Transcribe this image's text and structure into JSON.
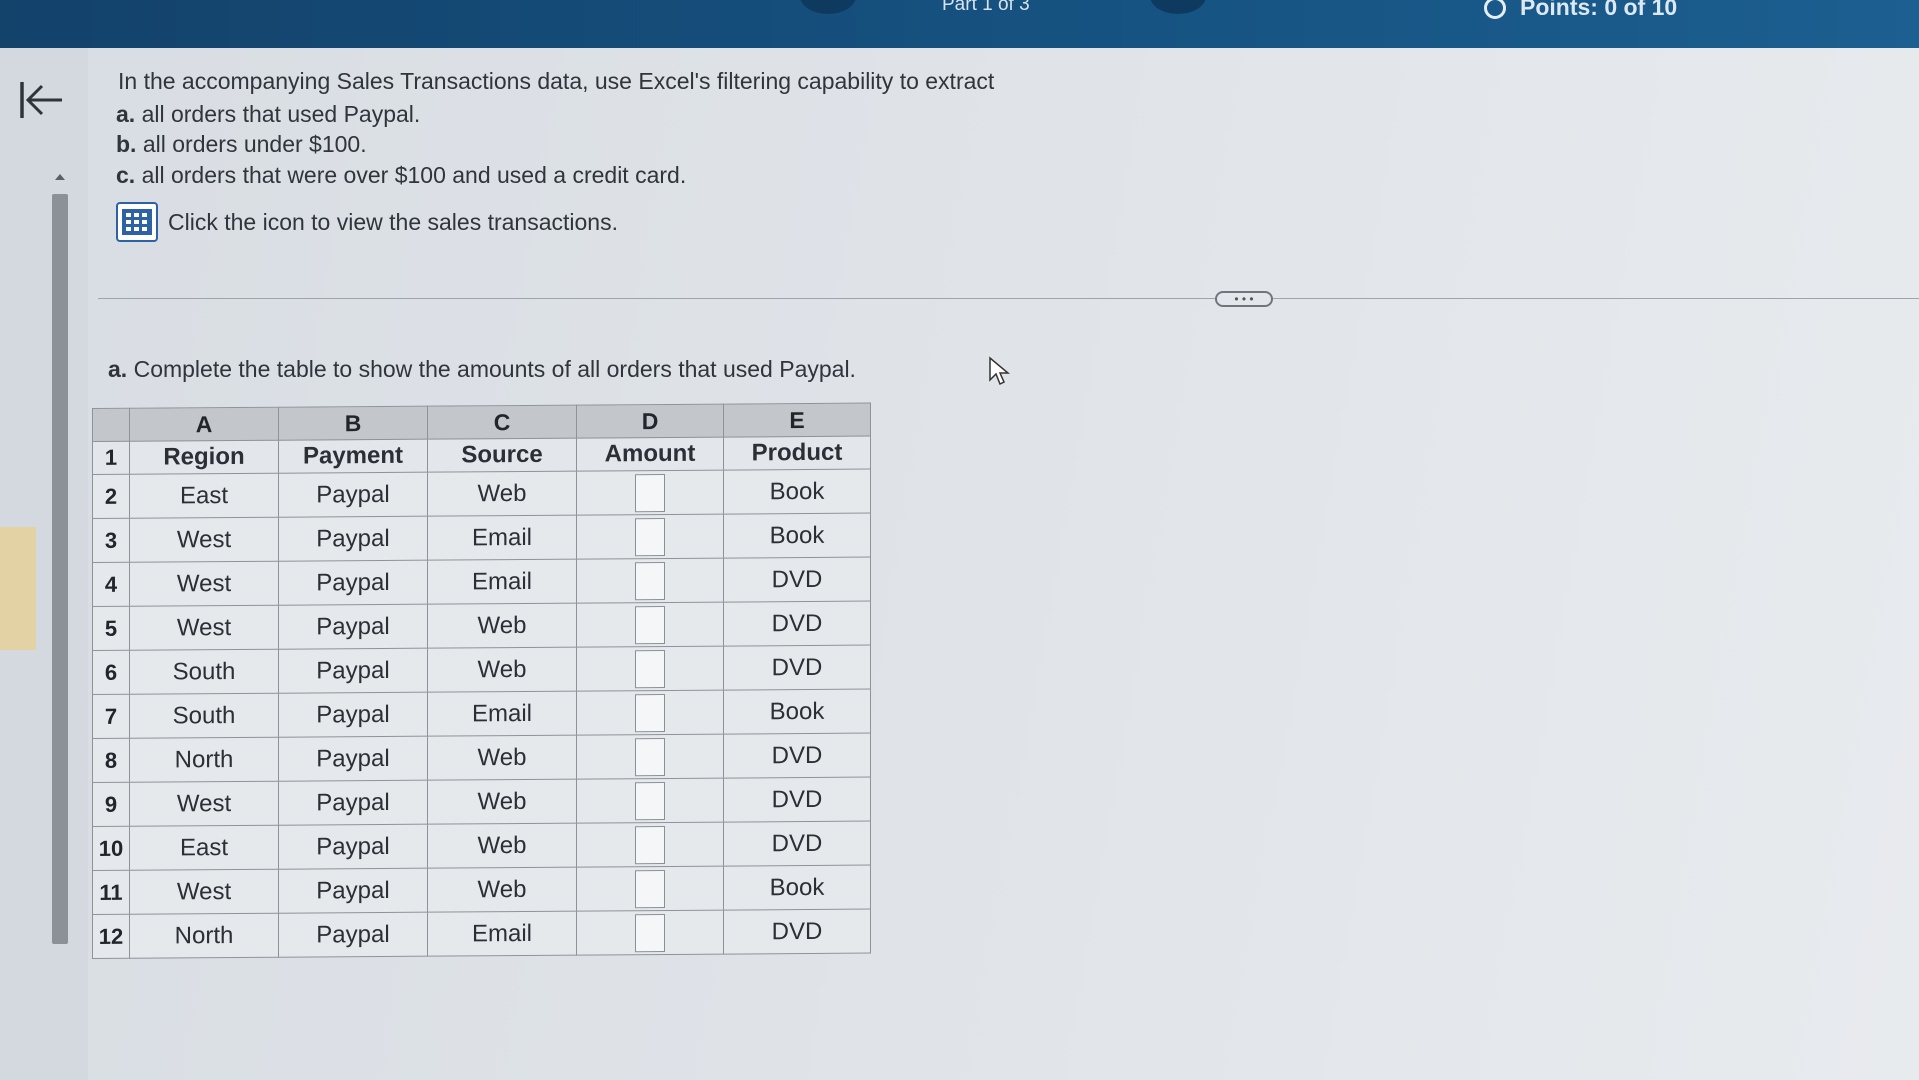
{
  "header": {
    "part": "Part 1 of 3",
    "points": "Points: 0 of 10"
  },
  "question": {
    "intro": "In the accompanying Sales Transactions data, use Excel's filtering capability to extract",
    "items": [
      {
        "letter": "a.",
        "text": "all orders that used Paypal."
      },
      {
        "letter": "b.",
        "text": "all orders under $100."
      },
      {
        "letter": "c.",
        "text": "all orders that were over $100 and used a credit card."
      }
    ],
    "view_link": "Click the icon to view the sales transactions."
  },
  "part_a": {
    "letter": "a.",
    "prompt": "Complete the table to show the amounts of all orders that used Paypal."
  },
  "table": {
    "col_letters": [
      "A",
      "B",
      "C",
      "D",
      "E"
    ],
    "header_row_num": "1",
    "headers": [
      "Region",
      "Payment",
      "Source",
      "Amount",
      "Product"
    ],
    "rows": [
      {
        "num": "2",
        "region": "East",
        "payment": "Paypal",
        "source": "Web",
        "amount": "",
        "product": "Book"
      },
      {
        "num": "3",
        "region": "West",
        "payment": "Paypal",
        "source": "Email",
        "amount": "",
        "product": "Book"
      },
      {
        "num": "4",
        "region": "West",
        "payment": "Paypal",
        "source": "Email",
        "amount": "",
        "product": "DVD"
      },
      {
        "num": "5",
        "region": "West",
        "payment": "Paypal",
        "source": "Web",
        "amount": "",
        "product": "DVD"
      },
      {
        "num": "6",
        "region": "South",
        "payment": "Paypal",
        "source": "Web",
        "amount": "",
        "product": "DVD"
      },
      {
        "num": "7",
        "region": "South",
        "payment": "Paypal",
        "source": "Email",
        "amount": "",
        "product": "Book"
      },
      {
        "num": "8",
        "region": "North",
        "payment": "Paypal",
        "source": "Web",
        "amount": "",
        "product": "DVD"
      },
      {
        "num": "9",
        "region": "West",
        "payment": "Paypal",
        "source": "Web",
        "amount": "",
        "product": "DVD"
      },
      {
        "num": "10",
        "region": "East",
        "payment": "Paypal",
        "source": "Web",
        "amount": "",
        "product": "DVD"
      },
      {
        "num": "11",
        "region": "West",
        "payment": "Paypal",
        "source": "Web",
        "amount": "",
        "product": "Book"
      },
      {
        "num": "12",
        "region": "North",
        "payment": "Paypal",
        "source": "Email",
        "amount": "",
        "product": "DVD"
      }
    ]
  },
  "colors": {
    "topbar": "#165382",
    "icon_blue": "#2d62a4",
    "scroll_thumb": "#8c9198",
    "yellow_tab": "#e3d2a3"
  },
  "icons": [
    "collapse-left-icon",
    "points-ring-icon",
    "spreadsheet-icon",
    "mouse-cursor-icon",
    "scroll-up-icon",
    "more-options-icon"
  ]
}
